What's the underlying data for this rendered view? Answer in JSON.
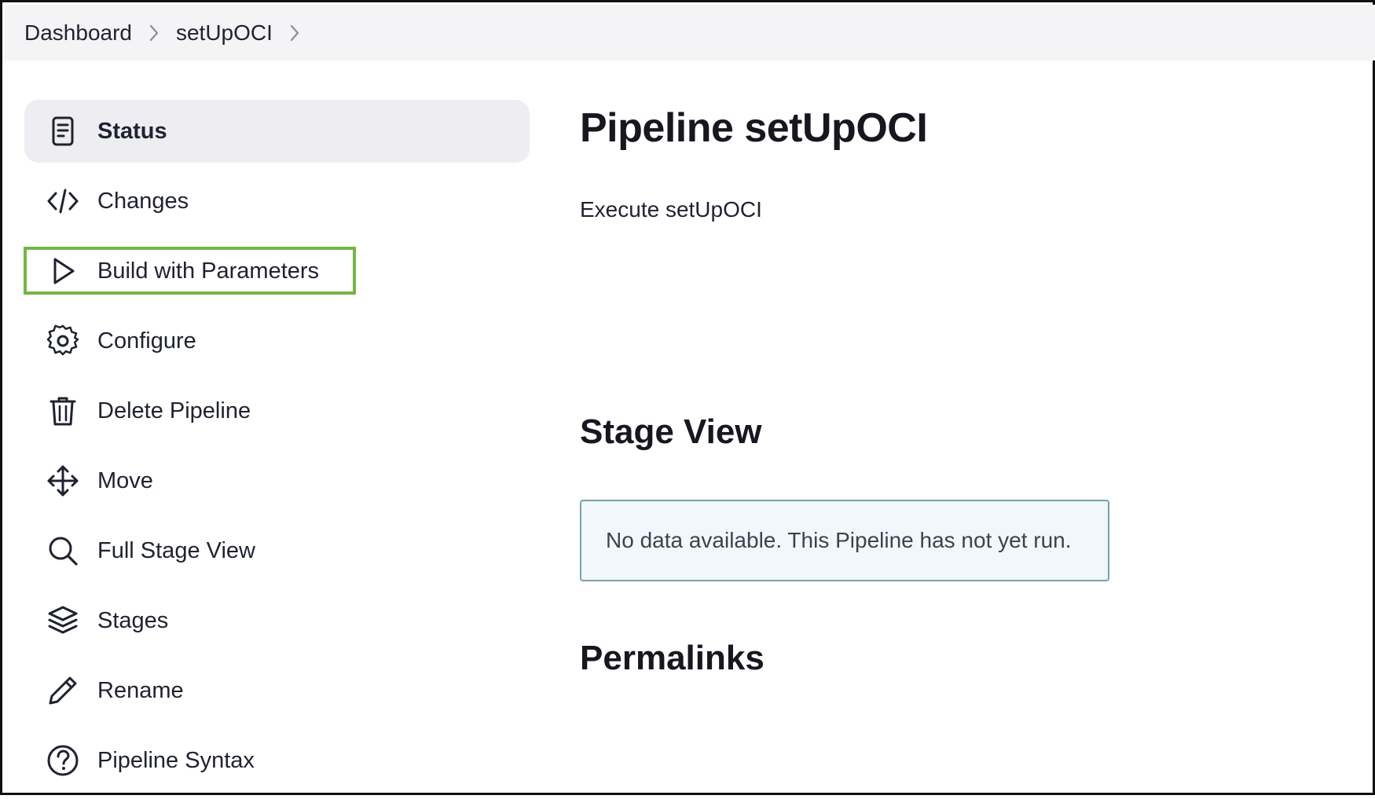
{
  "breadcrumb": {
    "items": [
      "Dashboard",
      "setUpOCI"
    ]
  },
  "sidebar": {
    "items": [
      {
        "label": "Status",
        "icon": "status-document-icon",
        "active": true
      },
      {
        "label": "Changes",
        "icon": "code-icon"
      },
      {
        "label": "Build with Parameters",
        "icon": "play-icon",
        "highlighted": true
      },
      {
        "label": "Configure",
        "icon": "gear-icon"
      },
      {
        "label": "Delete Pipeline",
        "icon": "trash-icon"
      },
      {
        "label": "Move",
        "icon": "move-arrows-icon"
      },
      {
        "label": "Full Stage View",
        "icon": "search-icon"
      },
      {
        "label": "Stages",
        "icon": "layers-icon"
      },
      {
        "label": "Rename",
        "icon": "pencil-icon"
      },
      {
        "label": "Pipeline Syntax",
        "icon": "help-circle-icon"
      }
    ],
    "highlight_color": "#72b643"
  },
  "main": {
    "title": "Pipeline setUpOCI",
    "description": "Execute setUpOCI",
    "stage_view_title": "Stage View",
    "stage_view_empty": "No data available. This Pipeline has not yet run.",
    "permalinks_title": "Permalinks"
  }
}
